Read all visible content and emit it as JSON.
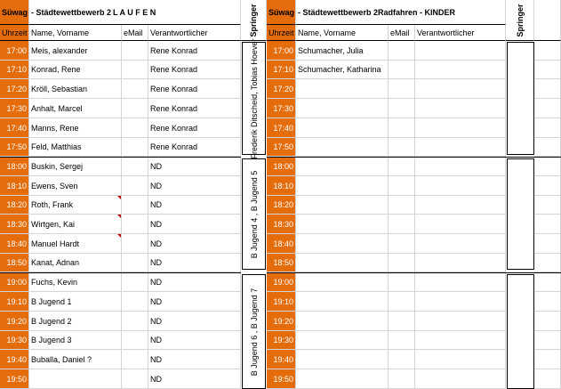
{
  "left": {
    "title_prefix": "Süwag",
    "title_rest": " - Städtewettbewerb 2",
    "title_sport": "L A U F E N",
    "columns": {
      "time": "Uhrzeit",
      "name": "Name, Vorname",
      "email": "eMail",
      "resp": "Verantwortlicher"
    },
    "springer_header": "Springer",
    "rows": [
      {
        "time": "17:00",
        "name": "Meis, alexander",
        "email": "",
        "resp": "Rene Konrad"
      },
      {
        "time": "17:10",
        "name": "Konrad, Rene",
        "email": "",
        "resp": "Rene Konrad"
      },
      {
        "time": "17:20",
        "name": "Kröll, Sebastian",
        "email": "",
        "resp": "Rene Konrad"
      },
      {
        "time": "17:30",
        "name": "Anhalt, Marcel",
        "email": "",
        "resp": "Rene Konrad"
      },
      {
        "time": "17:40",
        "name": "Manns, Rene",
        "email": "",
        "resp": "Rene Konrad"
      },
      {
        "time": "17:50",
        "name": "Feld, Matthias",
        "email": "",
        "resp": "Rene Konrad"
      },
      {
        "time": "18:00",
        "name": "Buskin, Sergej",
        "email": "",
        "resp": "ND"
      },
      {
        "time": "18:10",
        "name": "Ewens, Sven",
        "email": "",
        "resp": "ND"
      },
      {
        "time": "18:20",
        "name": "Roth, Frank",
        "email": "",
        "resp": "ND"
      },
      {
        "time": "18:30",
        "name": "Wirtgen, Kai",
        "email": "",
        "resp": "ND"
      },
      {
        "time": "18:40",
        "name": "Manuel Hardt",
        "email": "",
        "resp": "ND"
      },
      {
        "time": "18:50",
        "name": "Kanat, Adnan",
        "email": "",
        "resp": "ND"
      },
      {
        "time": "19:00",
        "name": "Fuchs, Kevin",
        "email": "",
        "resp": "ND"
      },
      {
        "time": "19:10",
        "name": "B Jugend 1",
        "email": "",
        "resp": "ND"
      },
      {
        "time": "19:20",
        "name": "B Jugend  2",
        "email": "",
        "resp": "ND"
      },
      {
        "time": "19:30",
        "name": "B Jugend  3",
        "email": "",
        "resp": "ND"
      },
      {
        "time": "19:40",
        "name": "Buballa, Daniel ?",
        "email": "",
        "resp": "ND"
      },
      {
        "time": "19:50",
        "name": "",
        "email": "",
        "resp": "ND"
      }
    ],
    "springer_groups": [
      {
        "text": "Frederik Ditscheid, Tobias Hoever"
      },
      {
        "text": "B Jugend 4 , B Jugend 5"
      },
      {
        "text": "B Jugend 6 , B Jugend 7"
      }
    ]
  },
  "right": {
    "title_prefix": "Süwag",
    "title_rest": " - Städtewettbewerb 2",
    "title_sport": "Radfahren - KINDER",
    "columns": {
      "time": "Uhrzeit",
      "name": "Name, Vorname",
      "email": "eMail",
      "resp": "Verantwortlicher"
    },
    "springer_header": "Springer",
    "rows": [
      {
        "time": "17:00",
        "name": "Schumacher, Julia",
        "email": "",
        "resp": ""
      },
      {
        "time": "17:10",
        "name": "Schumacher, Katharina",
        "email": "",
        "resp": ""
      },
      {
        "time": "17:20",
        "name": "",
        "email": "",
        "resp": ""
      },
      {
        "time": "17:30",
        "name": "",
        "email": "",
        "resp": ""
      },
      {
        "time": "17:40",
        "name": "",
        "email": "",
        "resp": ""
      },
      {
        "time": "17:50",
        "name": "",
        "email": "",
        "resp": ""
      },
      {
        "time": "18:00",
        "name": "",
        "email": "",
        "resp": ""
      },
      {
        "time": "18:10",
        "name": "",
        "email": "",
        "resp": ""
      },
      {
        "time": "18:20",
        "name": "",
        "email": "",
        "resp": ""
      },
      {
        "time": "18:30",
        "name": "",
        "email": "",
        "resp": ""
      },
      {
        "time": "18:40",
        "name": "",
        "email": "",
        "resp": ""
      },
      {
        "time": "18:50",
        "name": "",
        "email": "",
        "resp": ""
      },
      {
        "time": "19:00",
        "name": "",
        "email": "",
        "resp": ""
      },
      {
        "time": "19:10",
        "name": "",
        "email": "",
        "resp": ""
      },
      {
        "time": "19:20",
        "name": "",
        "email": "",
        "resp": ""
      },
      {
        "time": "19:30",
        "name": "",
        "email": "",
        "resp": ""
      },
      {
        "time": "19:40",
        "name": "",
        "email": "",
        "resp": ""
      },
      {
        "time": "19:50",
        "name": "",
        "email": "",
        "resp": ""
      }
    ]
  },
  "colors": {
    "time_bg": "#e46c0a",
    "comment_marker": "#c00000",
    "grid": "#d4d4d4"
  },
  "comment_rows": [
    8,
    9,
    10
  ]
}
